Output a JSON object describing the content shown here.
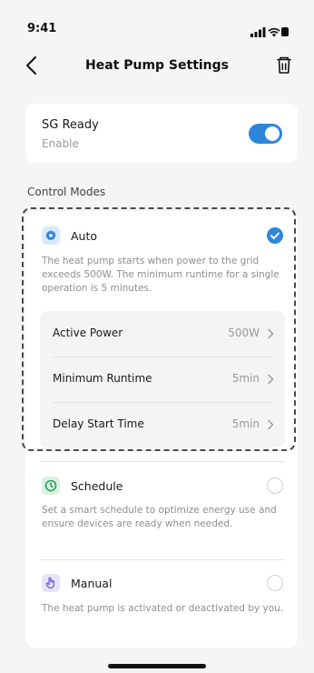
{
  "status": {
    "time": "9:41"
  },
  "header": {
    "title": "Heat Pump Settings"
  },
  "sg_ready": {
    "title": "SG Ready",
    "subtitle": "Enable",
    "enabled": true
  },
  "control_modes": {
    "label": "Control Modes",
    "modes": [
      {
        "name": "Auto",
        "description": "The heat pump starts when power to the grid exceeds 500W. The minimum runtime for a single operation is 5 minutes.",
        "selected": true,
        "icon": "gear-icon",
        "icon_color": "#2d86d9",
        "icon_bg": "#dbeaf8",
        "params": [
          {
            "label": "Active Power",
            "value": "500W"
          },
          {
            "label": "Minimum Runtime",
            "value": "5min"
          },
          {
            "label": "Delay Start Time",
            "value": "5min"
          }
        ]
      },
      {
        "name": "Schedule",
        "description": "Set a smart schedule to optimize energy use and ensure devices are ready when needed.",
        "selected": false,
        "icon": "clock-icon",
        "icon_color": "#2e9e5b",
        "icon_bg": "#d9f1e2"
      },
      {
        "name": "Manual",
        "description": "The heat pump is activated or deactivated by you.",
        "selected": false,
        "icon": "hand-icon",
        "icon_color": "#6a5bd1",
        "icon_bg": "#e6e3f8"
      }
    ]
  },
  "colors": {
    "accent": "#2d86d9",
    "background": "#f5f5f5",
    "card": "#ffffff"
  }
}
